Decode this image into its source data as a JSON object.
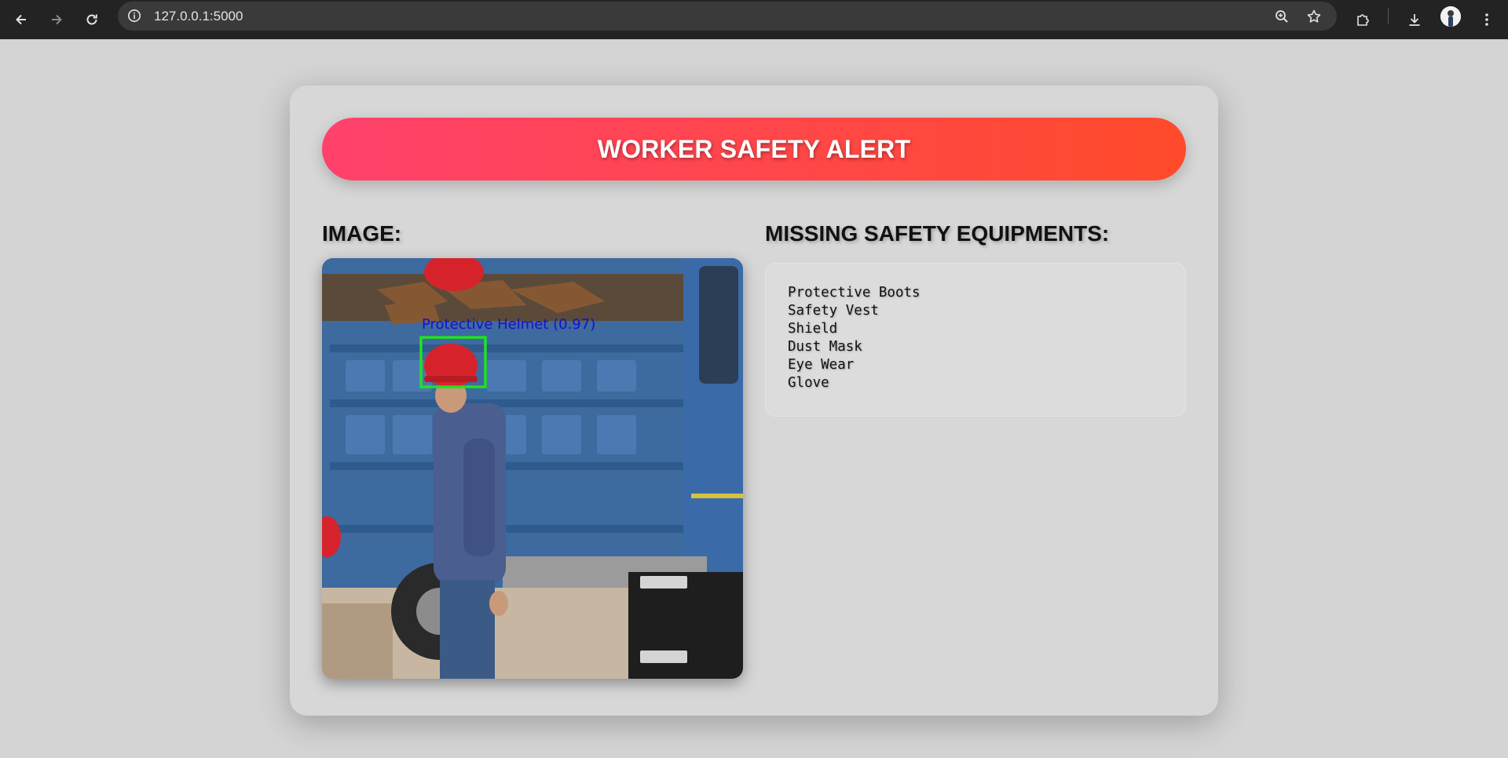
{
  "browser": {
    "url": "127.0.0.1:5000"
  },
  "page": {
    "banner_title": "WORKER SAFETY ALERT",
    "image_heading": "IMAGE:",
    "missing_heading": "MISSING SAFETY EQUIPMENTS:",
    "detection_label": "Protective Helmet (0.97)",
    "missing_items": [
      "Protective Boots",
      "Safety Vest",
      "Shield",
      "Dust Mask",
      "Eye Wear",
      "Glove"
    ]
  },
  "colors": {
    "banner_start": "#ff416c",
    "banner_end": "#ff4b2b",
    "detection_box": "#22e022",
    "detection_text": "#1a10c8"
  },
  "icons": [
    "back-arrow-icon",
    "forward-arrow-icon",
    "reload-icon",
    "site-info-icon",
    "zoom-icon",
    "bookmark-star-icon",
    "extensions-icon",
    "download-icon",
    "profile-avatar",
    "menu-dots-icon"
  ]
}
